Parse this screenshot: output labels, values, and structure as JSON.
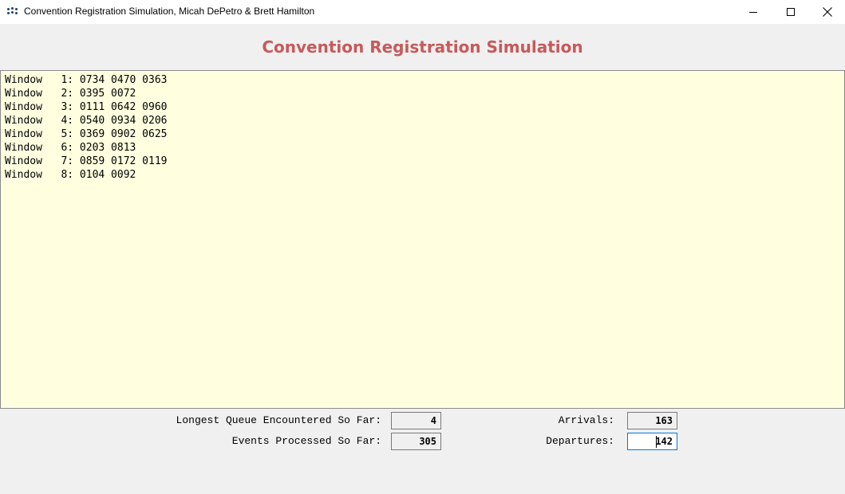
{
  "window": {
    "title": "Convention Registration Simulation, Micah DePetro & Brett Hamilton",
    "controls": [
      "minimize",
      "maximize",
      "close"
    ],
    "icons": {
      "app": "app-dots-icon"
    }
  },
  "heading": "Convention Registration Simulation",
  "output_lines": [
    "Window   1: 0734 0470 0363",
    "Window   2: 0395 0072",
    "Window   3: 0111 0642 0960",
    "Window   4: 0540 0934 0206",
    "Window   5: 0369 0902 0625",
    "Window   6: 0203 0813",
    "Window   7: 0859 0172 0119",
    "Window   8: 0104 0092"
  ],
  "stats": {
    "longest_queue_label": "Longest Queue Encountered So Far:",
    "longest_queue_value": "4",
    "events_label": "Events Processed So Far:",
    "events_value": "305",
    "arrivals_label": "Arrivals:",
    "arrivals_value": "163",
    "departures_label": "Departures:",
    "departures_value": "142"
  },
  "colors": {
    "heading": "#c8595a",
    "output_background": "#ffffe0",
    "focus_border": "#0078d7"
  }
}
